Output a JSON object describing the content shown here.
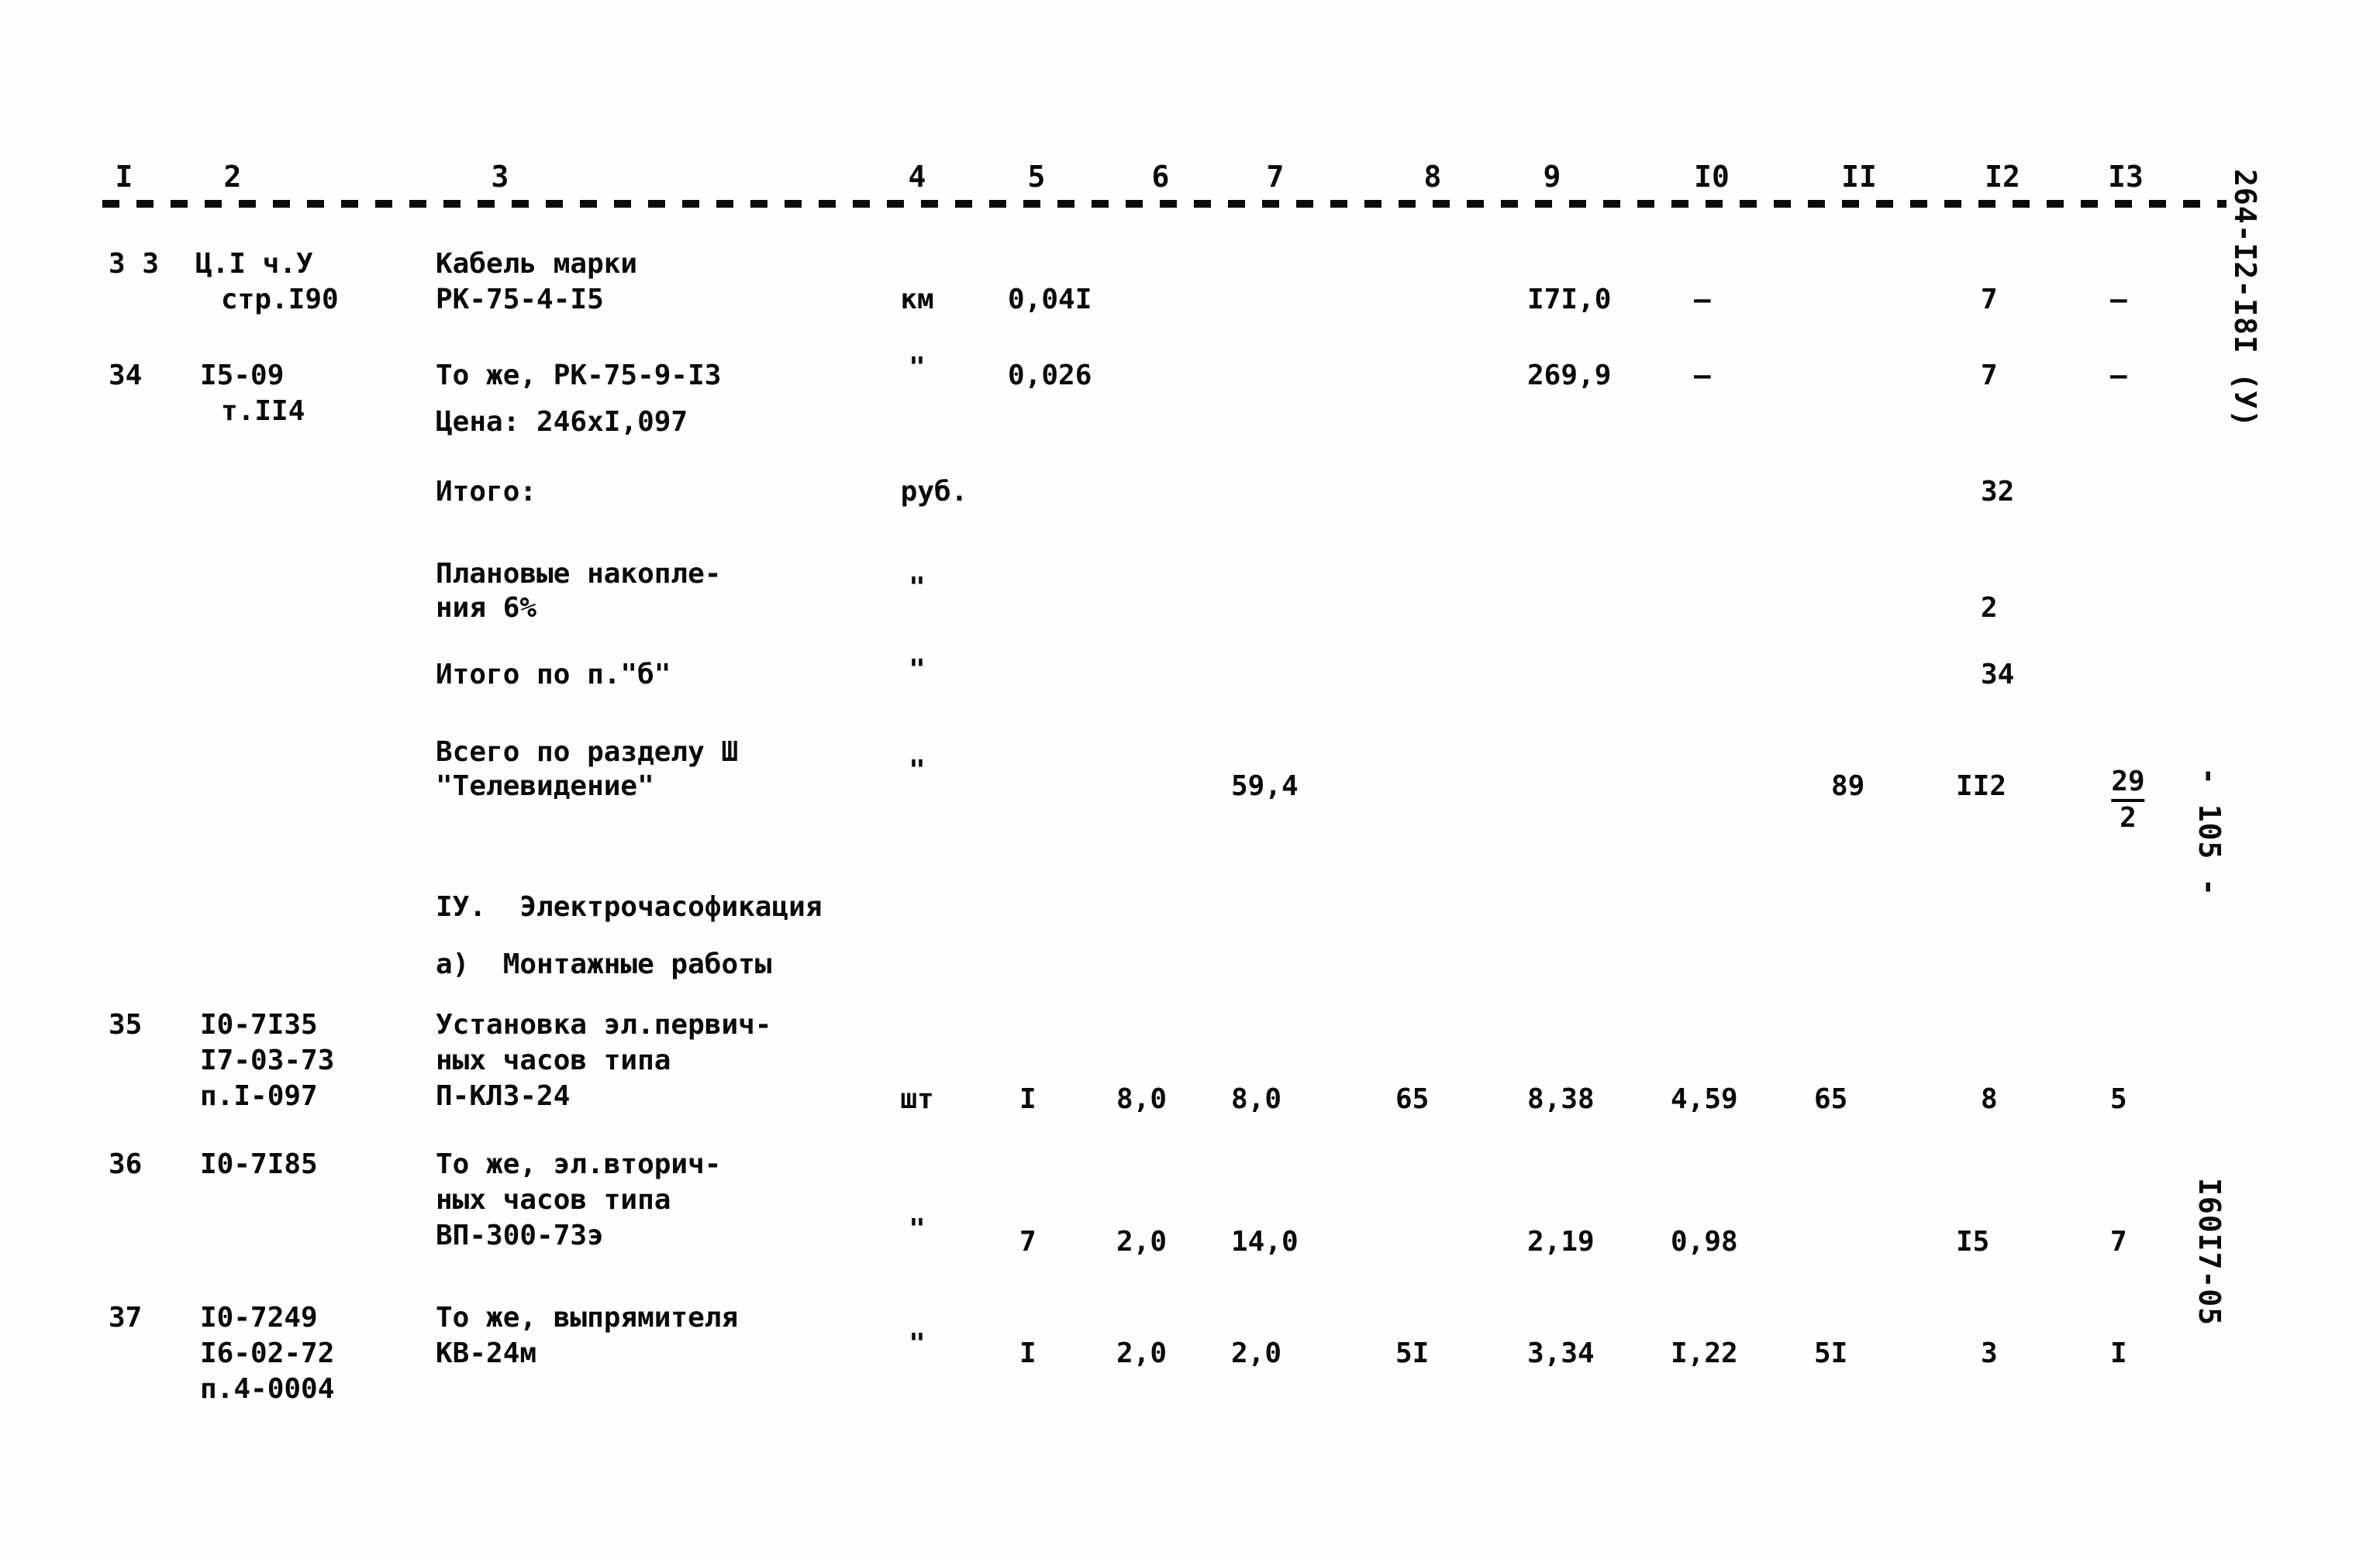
{
  "document": {
    "type": "construction-cost-estimate-sheet",
    "page_number_margin": "- 105 -",
    "doc_code_top_margin": "264-I2-I8I (У)",
    "doc_code_bottom_margin": "I60I7-05"
  },
  "table": {
    "column_headers": [
      "I",
      "2",
      "3",
      "4",
      "5",
      "6",
      "7",
      "8",
      "9",
      "I0",
      "II",
      "I2",
      "I3"
    ],
    "rows": [
      {
        "no": "3 3",
        "code_lines": [
          "Ц.I ч.У",
          "стр.I90"
        ],
        "desc_lines": [
          "Кабель марки",
          "РК-75-4-I5"
        ],
        "unit": "км",
        "c5": "0,04I",
        "c6": "",
        "c7": "",
        "c8": "",
        "c9": "I7I,0",
        "c10": "–",
        "c11": "",
        "c12": "7",
        "c13": "–"
      },
      {
        "no": "34",
        "code_lines": [
          "I5-09",
          "т.II4"
        ],
        "desc_lines": [
          "То же, РК-75-9-I3",
          "Цена: 246хI,097"
        ],
        "unit": "\"",
        "c5": "0,026",
        "c6": "",
        "c7": "",
        "c8": "",
        "c9": "269,9",
        "c10": "–",
        "c11": "",
        "c12": "7",
        "c13": "–"
      },
      {
        "no": "",
        "code_lines": [],
        "desc_lines": [
          "Итого:"
        ],
        "unit": "руб.",
        "c5": "",
        "c6": "",
        "c7": "",
        "c8": "",
        "c9": "",
        "c10": "",
        "c11": "",
        "c12": "32",
        "c13": ""
      },
      {
        "no": "",
        "code_lines": [],
        "desc_lines": [
          "Плановые накопле-",
          "ния 6%"
        ],
        "unit": "\"",
        "c5": "",
        "c6": "",
        "c7": "",
        "c8": "",
        "c9": "",
        "c10": "",
        "c11": "",
        "c12": "2",
        "c13": ""
      },
      {
        "no": "",
        "code_lines": [],
        "desc_lines": [
          "Итого по п.\"б\""
        ],
        "unit": "\"",
        "c5": "",
        "c6": "",
        "c7": "",
        "c8": "",
        "c9": "",
        "c10": "",
        "c11": "",
        "c12": "34",
        "c13": ""
      },
      {
        "no": "",
        "code_lines": [],
        "desc_lines": [
          "Всего по разделу Ш",
          "\"Телевидение\""
        ],
        "unit": "\"",
        "c5": "",
        "c6": "",
        "c7": "59,4",
        "c8": "",
        "c9": "",
        "c10": "",
        "c11": "89",
        "c12": "II2",
        "c13_fraction": {
          "numerator": "29",
          "denominator": "2"
        }
      },
      {
        "no": "35",
        "code_lines": [
          "I0-7I35",
          "I7-03-73",
          "п.I-097"
        ],
        "desc_lines": [
          "Установка эл.первич-",
          "ных часов типа",
          "П-КЛЗ-24"
        ],
        "unit": "шт",
        "c5": "I",
        "c6": "8,0",
        "c7": "8,0",
        "c8": "65",
        "c9": "8,38",
        "c10": "4,59",
        "c11": "65",
        "c12": "8",
        "c13": "5"
      },
      {
        "no": "36",
        "code_lines": [
          "I0-7I85"
        ],
        "desc_lines": [
          "То же, эл.вторич-",
          "ных часов типа",
          "ВП-300-73э"
        ],
        "unit": "\"",
        "c5": "7",
        "c6": "2,0",
        "c7": "14,0",
        "c8": "",
        "c9": "2,19",
        "c10": "0,98",
        "c11": "",
        "c12": "I5",
        "c13": "7"
      },
      {
        "no": "37",
        "code_lines": [
          "I0-7249",
          "I6-02-72",
          "п.4-0004"
        ],
        "desc_lines": [
          "То же, выпрямителя",
          "КВ-24м"
        ],
        "unit": "\"",
        "c5": "I",
        "c6": "2,0",
        "c7": "2,0",
        "c8": "5I",
        "c9": "3,34",
        "c10": "I,22",
        "c11": "5I",
        "c12": "3",
        "c13": "I"
      }
    ]
  },
  "sections": {
    "chapter_title": "ІУ.  Электрочасофикация",
    "subsection_title": "а)  Монтажные работы"
  }
}
